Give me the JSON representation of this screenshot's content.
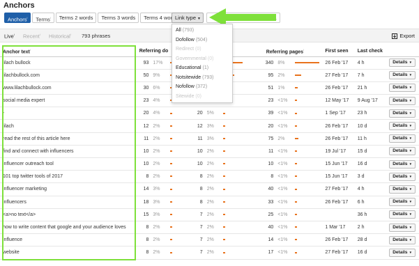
{
  "page": {
    "title": "Anchors"
  },
  "tabs": [
    {
      "label": "Anchors",
      "sup": "i"
    },
    {
      "label": "Terms",
      "sup": "i"
    },
    {
      "label": "Terms 2 words",
      "sup": ""
    },
    {
      "label": "Terms 3 words",
      "sup": ""
    },
    {
      "label": "Terms 4 words",
      "sup": ""
    }
  ],
  "link_type": {
    "label": "Link type"
  },
  "subbar": {
    "live": "Live",
    "recent": "Recent",
    "historical": "Historical",
    "phrases": "793 phrases",
    "export": "Export"
  },
  "dropdown": [
    {
      "label": "All",
      "count": "(793)",
      "disabled": false
    },
    {
      "label": "Dofollow",
      "count": "(504)",
      "disabled": false
    },
    {
      "label": "Redirect",
      "count": "(0)",
      "disabled": true
    },
    {
      "label": "Governmental",
      "count": "(0)",
      "disabled": true
    },
    {
      "label": "Educational",
      "count": "(1)",
      "disabled": false
    },
    {
      "label": "Notsitewide",
      "count": "(793)",
      "disabled": false
    },
    {
      "label": "Nofollow",
      "count": "(372)",
      "disabled": false
    },
    {
      "label": "Sitewide",
      "count": "(0)",
      "disabled": true
    }
  ],
  "columns": {
    "anchor": "Anchor text",
    "ref_domains": "Referring do",
    "ref_pages": "Referring pages",
    "first_seen": "First seen",
    "last_check": "Last check"
  },
  "details_label": "Details",
  "rows": [
    {
      "anchor": "lilach bullock",
      "rd": "93",
      "rdp": "17%",
      "rd_frac": 0.17,
      "c2": "",
      "c2p": "",
      "c2_frac": 0.5,
      "rp": "340",
      "rpp": "8%",
      "rp_frac": 0.8,
      "first": "26 Feb '17",
      "last": "4 h"
    },
    {
      "anchor": "lilachbullock.com",
      "rd": "50",
      "rdp": "9%",
      "rd_frac": 0.09,
      "c2": "",
      "c2p": "",
      "c2_frac": 0.28,
      "rp": "95",
      "rpp": "2%",
      "rp_frac": 0.2,
      "first": "27 Feb '17",
      "last": "7 h"
    },
    {
      "anchor": "www.lilachbullock.com",
      "rd": "30",
      "rdp": "6%",
      "rd_frac": 0.06,
      "c2": "",
      "c2p": "",
      "c2_frac": 0.18,
      "rp": "51",
      "rpp": "1%",
      "rp_frac": 0.1,
      "first": "26 Feb '17",
      "last": "21 h"
    },
    {
      "anchor": "social media expert",
      "rd": "23",
      "rdp": "4%",
      "rd_frac": 0.04,
      "c2": "23",
      "c2p": "6%",
      "c2_frac": 0.06,
      "rp": "23",
      "rpp": "<1%",
      "rp_frac": 0.05,
      "first": "12 May '17",
      "last": "9 Aug '17"
    },
    {
      "anchor": "-",
      "rd": "20",
      "rdp": "4%",
      "rd_frac": 0.04,
      "c2": "20",
      "c2p": "5%",
      "c2_frac": 0.05,
      "rp": "39",
      "rpp": "<1%",
      "rp_frac": 0.06,
      "first": "1 Sep '17",
      "last": "23 h"
    },
    {
      "anchor": "lilach",
      "rd": "12",
      "rdp": "2%",
      "rd_frac": 0.02,
      "c2": "12",
      "c2p": "3%",
      "c2_frac": 0.03,
      "rp": "20",
      "rpp": "<1%",
      "rp_frac": 0.04,
      "first": "26 Feb '17",
      "last": "10 d"
    },
    {
      "anchor": "read the rest of this article here",
      "rd": "11",
      "rdp": "2%",
      "rd_frac": 0.02,
      "c2": "11",
      "c2p": "3%",
      "c2_frac": 0.03,
      "rp": "75",
      "rpp": "2%",
      "rp_frac": 0.12,
      "first": "26 Feb '17",
      "last": "11 h"
    },
    {
      "anchor": "find and connect with influencers",
      "rd": "10",
      "rdp": "2%",
      "rd_frac": 0.02,
      "c2": "10",
      "c2p": "2%",
      "c2_frac": 0.02,
      "rp": "11",
      "rpp": "<1%",
      "rp_frac": 0.02,
      "first": "19 Jul '17",
      "last": "15 d"
    },
    {
      "anchor": "influencer outreach tool",
      "rd": "10",
      "rdp": "2%",
      "rd_frac": 0.02,
      "c2": "10",
      "c2p": "2%",
      "c2_frac": 0.02,
      "rp": "10",
      "rpp": "<1%",
      "rp_frac": 0.02,
      "first": "15 Jun '17",
      "last": "16 d"
    },
    {
      "anchor": "101 top twitter tools of 2017",
      "rd": "8",
      "rdp": "2%",
      "rd_frac": 0.02,
      "c2": "8",
      "c2p": "2%",
      "c2_frac": 0.02,
      "rp": "8",
      "rpp": "<1%",
      "rp_frac": 0.02,
      "first": "15 Jun '17",
      "last": "3 d"
    },
    {
      "anchor": "influencer marketing",
      "rd": "14",
      "rdp": "3%",
      "rd_frac": 0.03,
      "c2": "8",
      "c2p": "2%",
      "c2_frac": 0.02,
      "rp": "40",
      "rpp": "<1%",
      "rp_frac": 0.06,
      "first": "27 Feb '17",
      "last": "4 h"
    },
    {
      "anchor": "influencers",
      "rd": "18",
      "rdp": "3%",
      "rd_frac": 0.03,
      "c2": "8",
      "c2p": "2%",
      "c2_frac": 0.02,
      "rp": "33",
      "rpp": "<1%",
      "rp_frac": 0.05,
      "first": "26 Feb '17",
      "last": "6 h"
    },
    {
      "anchor": "<a>no text</a>",
      "rd": "15",
      "rdp": "3%",
      "rd_frac": 0.03,
      "c2": "7",
      "c2p": "2%",
      "c2_frac": 0.02,
      "rp": "25",
      "rpp": "<1%",
      "rp_frac": 0.04,
      "first": "",
      "last": "36 h"
    },
    {
      "anchor": "how to write content that google and your audience loves",
      "rd": "8",
      "rdp": "2%",
      "rd_frac": 0.02,
      "c2": "7",
      "c2p": "2%",
      "c2_frac": 0.02,
      "rp": "40",
      "rpp": "<1%",
      "rp_frac": 0.06,
      "first": "1 Mar '17",
      "last": "2 h"
    },
    {
      "anchor": "influence",
      "rd": "8",
      "rdp": "2%",
      "rd_frac": 0.02,
      "c2": "7",
      "c2p": "2%",
      "c2_frac": 0.02,
      "rp": "14",
      "rpp": "<1%",
      "rp_frac": 0.03,
      "first": "26 Feb '17",
      "last": "28 d"
    },
    {
      "anchor": "website",
      "rd": "8",
      "rdp": "2%",
      "rd_frac": 0.02,
      "c2": "7",
      "c2p": "2%",
      "c2_frac": 0.02,
      "rp": "17",
      "rpp": "<1%",
      "rp_frac": 0.03,
      "first": "27 Feb '17",
      "last": "16 d"
    }
  ],
  "colors": {
    "accent": "#1f5fa8",
    "bar": "#e8721c",
    "highlight": "#7ee03a",
    "arrow": "#7ee03a"
  }
}
